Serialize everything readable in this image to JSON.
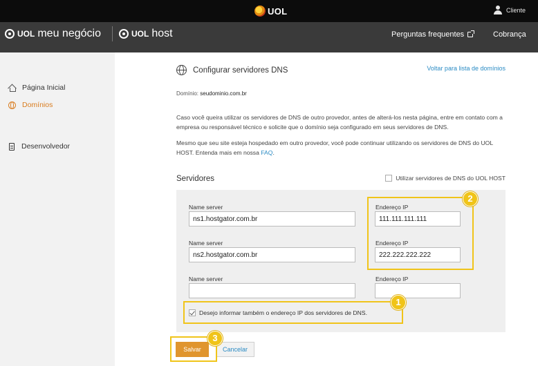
{
  "topbar": {
    "logo_text": "UOL",
    "user_label": "Cliente"
  },
  "subbar": {
    "brand1_uol": "UOL",
    "brand1_name": "meu negócio",
    "brand2_uol": "UOL",
    "brand2_name": "host",
    "nav": {
      "faq": "Perguntas frequentes",
      "billing": "Cobrança"
    }
  },
  "sidebar": {
    "items": [
      {
        "label": "Página Inicial",
        "icon": "home-icon"
      },
      {
        "label": "Domínios",
        "icon": "globe-icon",
        "active": true
      },
      {
        "label": "Desenvolvedor",
        "icon": "developer-icon"
      }
    ]
  },
  "main": {
    "title": "Configurar servidores DNS",
    "back_link": "Voltar para lista de domínios",
    "domain_label": "Domínio:",
    "domain_value": "seudominio.com.br",
    "para1": "Caso você queira utilizar os servidores de DNS de outro provedor, antes de alterá-los nesta página, entre em contato com a empresa ou responsável técnico e solicite que o domínio seja configurado em seus servidores de DNS.",
    "para2_text": "Mesmo que seu site esteja hospedado em outro provedor, você pode continuar utilizando os servidores de DNS do UOL HOST. Entenda mais em nossa",
    "para2_link": "FAQ",
    "para2_end": ".",
    "servers_title": "Servidores",
    "uolhost_checkbox": "Utilizar servidores de DNS do UOL HOST",
    "servers": [
      {
        "ns_label": "Name server",
        "ns_value": "ns1.hostgator.com.br",
        "ip_label": "Endereço IP",
        "ip_value": "111.111.111.111"
      },
      {
        "ns_label": "Name server",
        "ns_value": "ns2.hostgator.com.br",
        "ip_label": "Endereço IP",
        "ip_value": "222.222.222.222"
      },
      {
        "ns_label": "Name server",
        "ns_value": "",
        "ip_label": "Endereço IP",
        "ip_value": ""
      }
    ],
    "ip_checkbox": "Desejo informar também o endereço IP dos servidores de DNS.",
    "save": "Salvar",
    "cancel": "Cancelar"
  },
  "markers": [
    "1",
    "2",
    "3"
  ],
  "colors": {
    "accent": "#e0952e",
    "link": "#2a8bc4",
    "highlight": "#f0c419",
    "topbar": "#0c0c0c",
    "subbar": "#3a3a3a"
  }
}
